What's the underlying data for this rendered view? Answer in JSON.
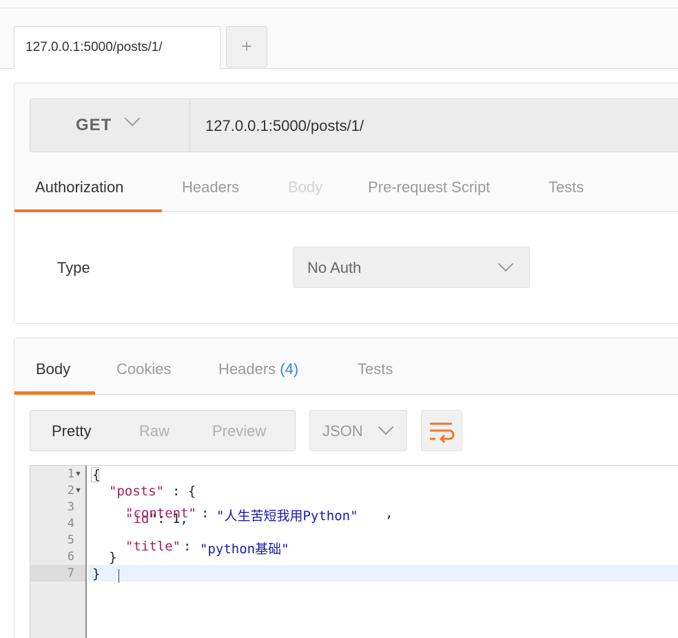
{
  "tabs": {
    "active_label": "127.0.0.1:5000/posts/1/",
    "add_label": "+"
  },
  "request": {
    "method": "GET",
    "url": "127.0.0.1:5000/posts/1/",
    "tabs": [
      "Authorization",
      "Headers",
      "Body",
      "Pre-request Script",
      "Tests"
    ],
    "active_tab": "Authorization",
    "auth_type_label": "Type",
    "auth_type_value": "No Auth"
  },
  "response": {
    "tabs": {
      "body": "Body",
      "cookies": "Cookies",
      "headers": "Headers",
      "headers_count": "(4)",
      "tests": "Tests"
    },
    "view_modes": [
      "Pretty",
      "Raw",
      "Preview"
    ],
    "active_view": "Pretty",
    "format": "JSON",
    "line_numbers": [
      "1",
      "2",
      "3",
      "4",
      "5",
      "6",
      "7"
    ],
    "json": {
      "open_brace": "{",
      "posts_key": "\"posts\"",
      "posts_sep": ": {",
      "content_key": "\"content\"",
      "content_value": "\"人生苦短我用Python\"",
      "id_key": "\"id\"",
      "id_value": "1,",
      "title_key": "\"title\"",
      "title_value": "\"python基础\"",
      "inner_close": "}",
      "outer_close": "}"
    }
  },
  "colors": {
    "accent": "#f0772b",
    "link_blue": "#2a8ad4",
    "json_key": "#a0215f",
    "json_string": "#1a1aa6"
  }
}
